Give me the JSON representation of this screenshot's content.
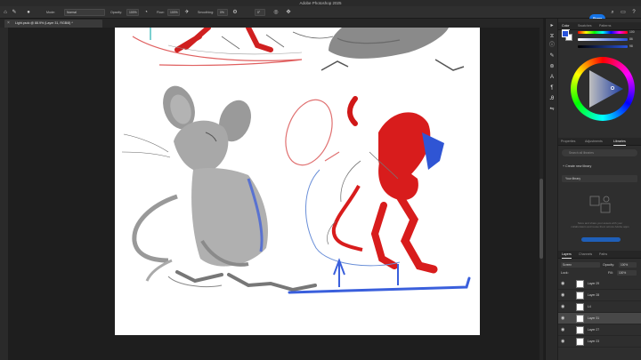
{
  "app": {
    "title": "Adobe Photoshop 2025"
  },
  "options_bar": {
    "mode_label": "Mode:",
    "mode_value": "Normal",
    "opacity_label": "Opacity:",
    "opacity_value": "100%",
    "flow_label": "Flow:",
    "flow_value": "100%",
    "smoothing_label": "Smoothing:",
    "smoothing_value": "0%",
    "angle_value": "0°",
    "share_label": "Share"
  },
  "document_tab": {
    "label": "Light.psdc @ 88.9% (Layer 31, RGB/8) *"
  },
  "panels": {
    "color_tabs": [
      "Color",
      "Swatches",
      "Patterns"
    ],
    "color": {
      "foreground": "#2953d9",
      "background": "#ffffff",
      "val1": "100",
      "val2": "86",
      "val3": "98"
    },
    "libraries_tabs": [
      "Properties",
      "Adjustments",
      "Libraries"
    ],
    "libraries": {
      "search_placeholder": "Search all libraries",
      "create_label": "Create new library",
      "your_libraries": "Your library",
      "empty_text": "Store and share your assets with your collaborators and reuse them across Adobe apps"
    },
    "layers_tabs": [
      "Layers",
      "Channels",
      "Paths"
    ],
    "layers": {
      "blend_mode": "Screen",
      "opacity_label": "Opacity:",
      "opacity_value": "100%",
      "lock_label": "Lock:",
      "fill_label": "Fill:",
      "fill_value": "100%",
      "items": [
        {
          "name": "Layer 29"
        },
        {
          "name": "Layer 28"
        },
        {
          "name": "L4"
        },
        {
          "name": "Layer 31"
        },
        {
          "name": "Layer 27"
        },
        {
          "name": "Layer 23"
        }
      ]
    }
  },
  "colors": {
    "accent": "#1473e6",
    "sketch_red": "#e02020",
    "sketch_blue": "#2f55d4"
  },
  "icons": [
    "brush-icon",
    "home-icon",
    "search-icon",
    "help-icon",
    "close-icon",
    "eye-icon"
  ]
}
